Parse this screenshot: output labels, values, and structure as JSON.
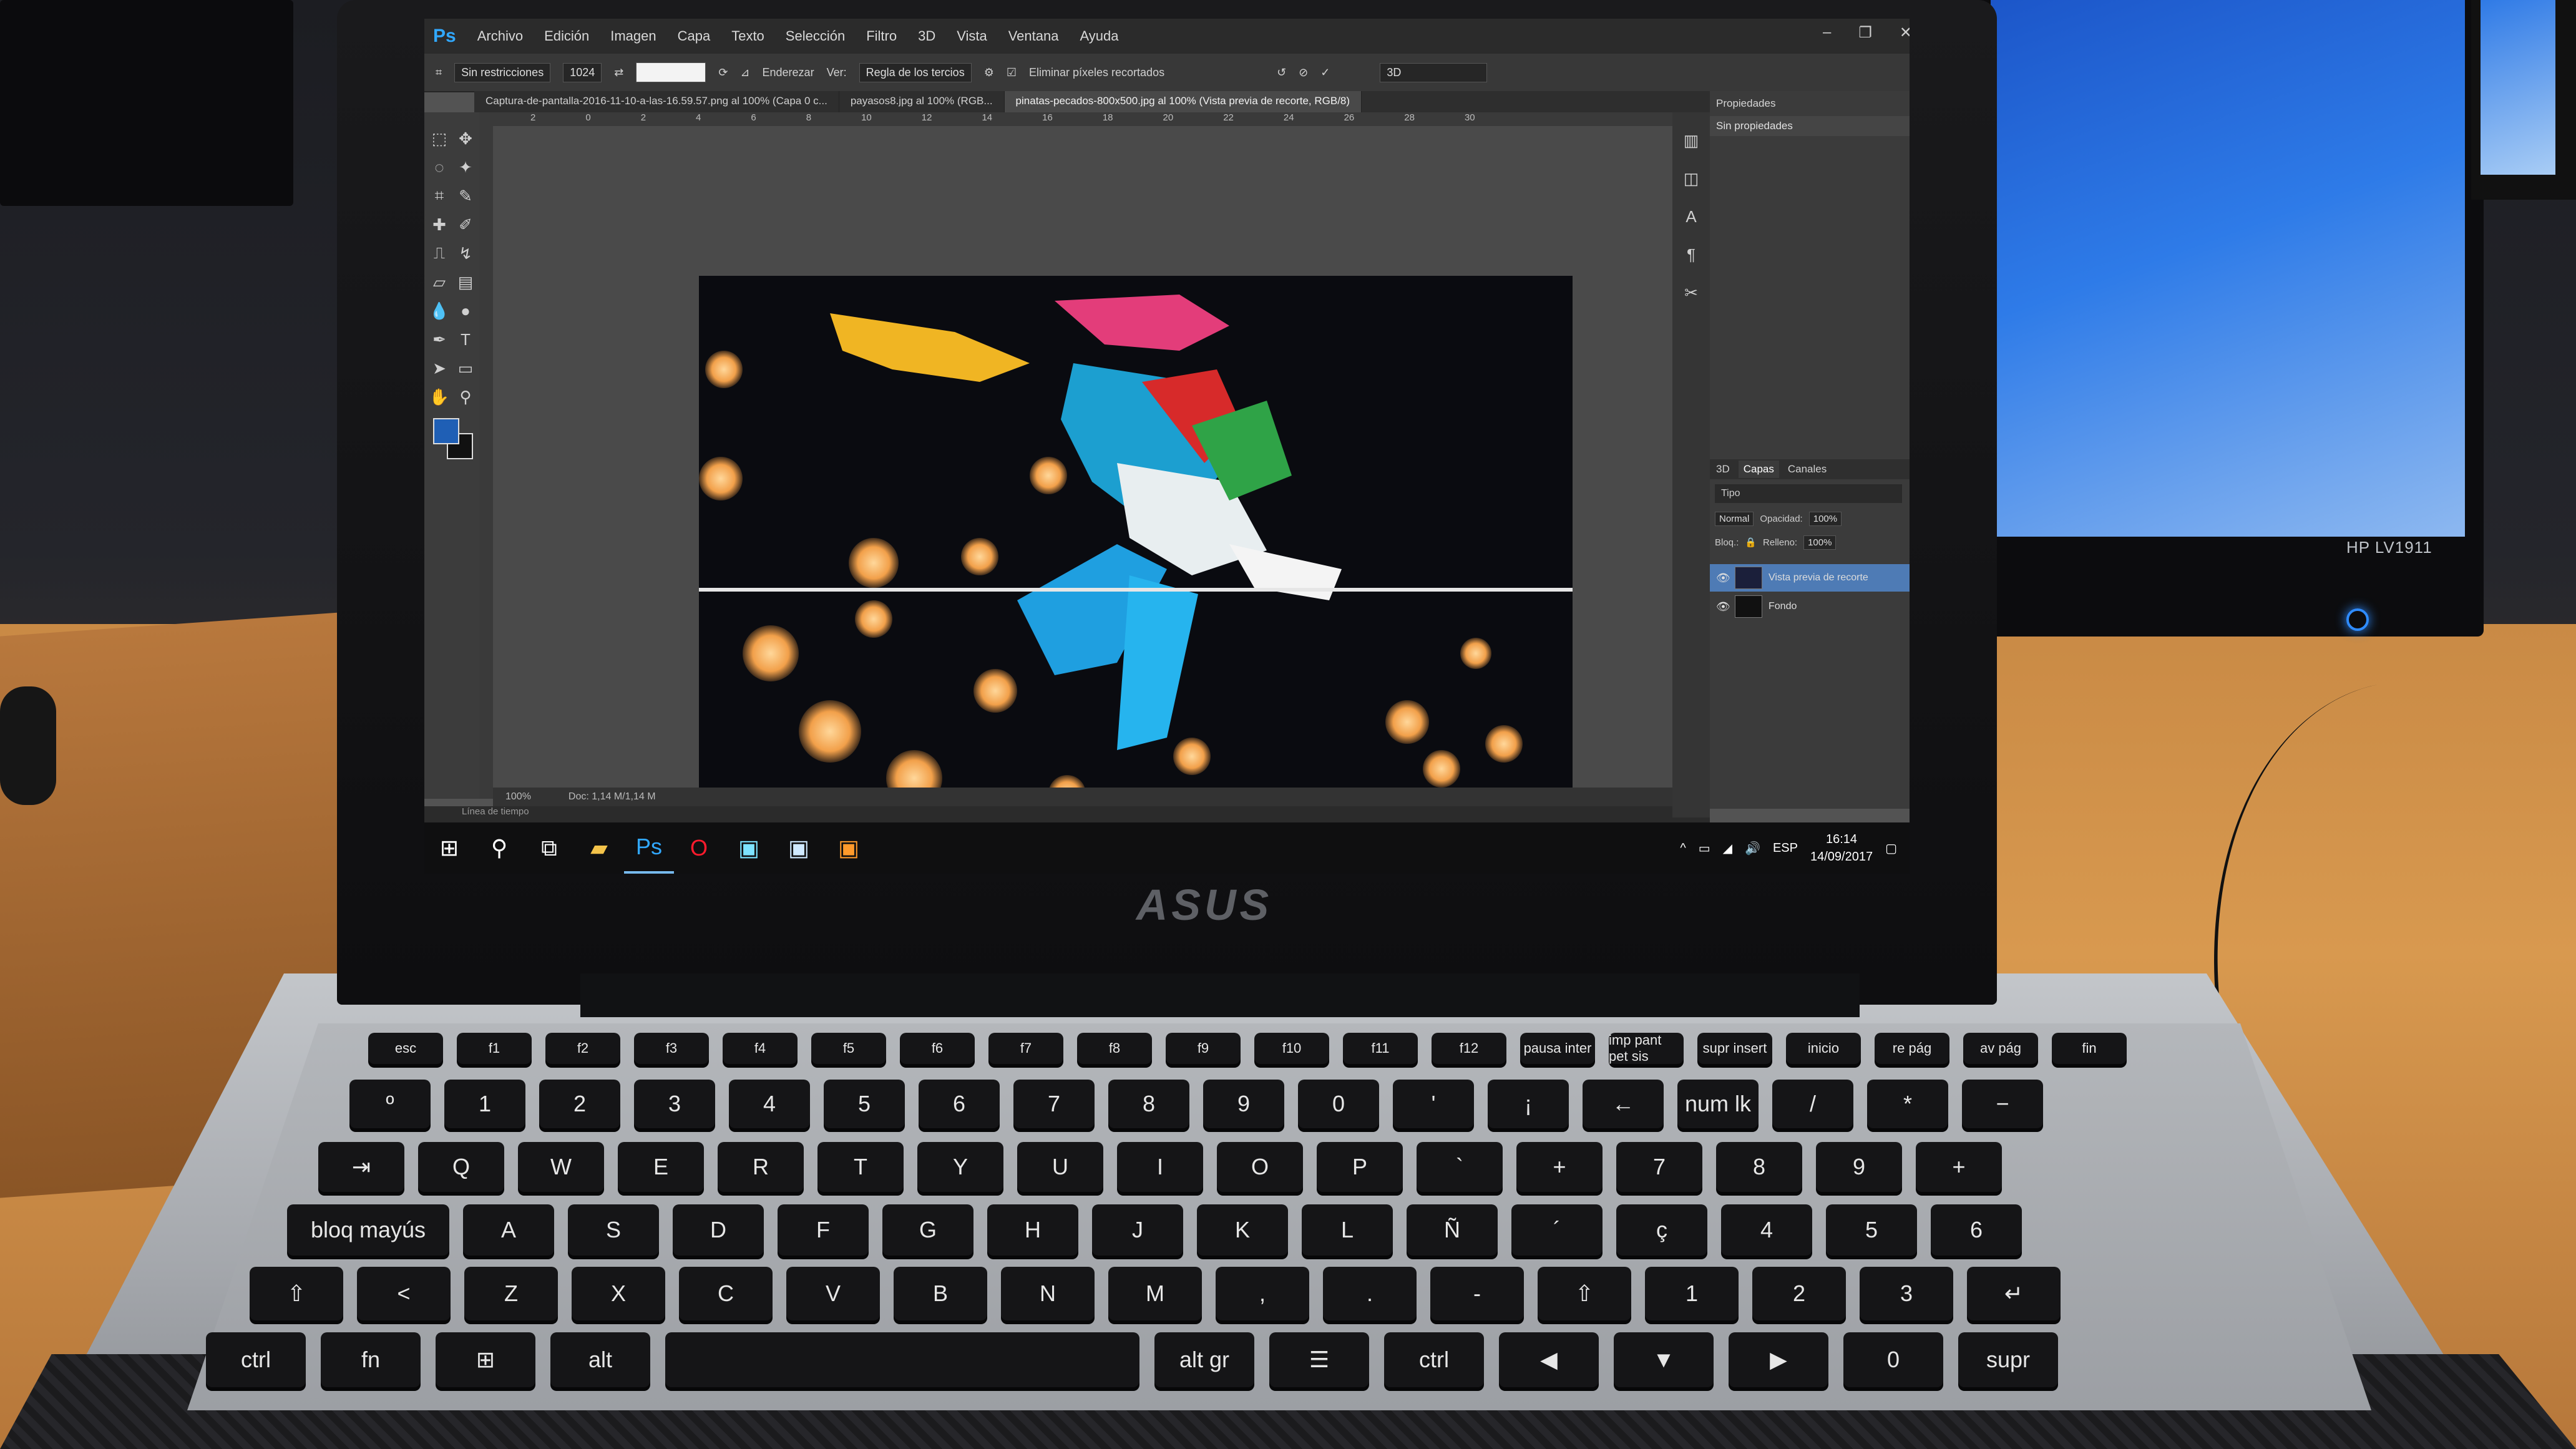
{
  "photoshop": {
    "menu": [
      "Archivo",
      "Edición",
      "Imagen",
      "Capa",
      "Texto",
      "Selección",
      "Filtro",
      "3D",
      "Vista",
      "Ventana",
      "Ayuda"
    ],
    "logo": "Ps",
    "options": {
      "ratio": "Sin restricciones",
      "width": "1024",
      "straighten": "Enderezar",
      "view_label": "Ver:",
      "view_value": "Regla de los tercios",
      "delete_cropped": "Eliminar píxeles recortados",
      "workspace": "3D"
    },
    "tabs": [
      "Captura-de-pantalla-2016-11-10-a-las-16.59.57.png al 100% (Capa 0 c...",
      "payasos8.jpg al 100% (RGB...",
      "pinatas-pecados-800x500.jpg al 100% (Vista previa de recorte, RGB/8)"
    ],
    "ruler_ticks": [
      "2",
      "0",
      "2",
      "4",
      "6",
      "8",
      "10",
      "12",
      "14",
      "16",
      "18",
      "20",
      "22",
      "24",
      "26",
      "28",
      "30"
    ],
    "statusbar": {
      "zoom": "100%",
      "doc": "Doc: 1,14 M/1,14 M"
    },
    "timeline_label": "Línea de tiempo",
    "properties": {
      "title": "Propiedades",
      "value": "Sin propiedades"
    },
    "layers": {
      "tabs": [
        "3D",
        "Capas",
        "Canales"
      ],
      "kind": "Tipo",
      "blend": "Normal",
      "opacity_label": "Opacidad:",
      "opacity": "100%",
      "lock_label": "Bloq.:",
      "fill_label": "Relleno:",
      "fill": "100%",
      "items": [
        {
          "name": "Vista previa de recorte",
          "selected": true
        },
        {
          "name": "Fondo",
          "selected": false
        }
      ]
    }
  },
  "taskbar": {
    "language": "ESP",
    "time": "16:14",
    "date": "14/09/2017"
  },
  "laptop": {
    "brand": "ASUS"
  },
  "background": {
    "monitor_brand": "HP LV1911"
  },
  "keyboard": {
    "row_fn": [
      "esc",
      "f1",
      "f2",
      "f3",
      "f4",
      "f5",
      "f6",
      "f7",
      "f8",
      "f9",
      "f10",
      "f11",
      "f12",
      "pausa inter",
      "imp pant pet sis",
      "supr insert",
      "inicio",
      "re pág",
      "av pág",
      "fin"
    ],
    "row_num": [
      "º",
      "1",
      "2",
      "3",
      "4",
      "5",
      "6",
      "7",
      "8",
      "9",
      "0",
      "'",
      "¡",
      "←",
      "num lk",
      "/",
      "*",
      "−"
    ],
    "row_q": [
      "⇥",
      "Q",
      "W",
      "E",
      "R",
      "T",
      "Y",
      "U",
      "I",
      "O",
      "P",
      "`",
      "+",
      "7",
      "8",
      "9",
      "+"
    ],
    "row_a": [
      "bloq mayús",
      "A",
      "S",
      "D",
      "F",
      "G",
      "H",
      "J",
      "K",
      "L",
      "Ñ",
      "´",
      "ç",
      "4",
      "5",
      "6"
    ],
    "row_z": [
      "⇧",
      "<",
      "Z",
      "X",
      "C",
      "V",
      "B",
      "N",
      "M",
      ",",
      ".",
      "-",
      "⇧",
      "1",
      "2",
      "3",
      "↵"
    ],
    "row_space": [
      "ctrl",
      "fn",
      "⊞",
      "alt",
      "",
      "alt gr",
      "☰",
      "ctrl",
      "◀",
      "▼",
      "▶",
      "0",
      "supr"
    ]
  }
}
